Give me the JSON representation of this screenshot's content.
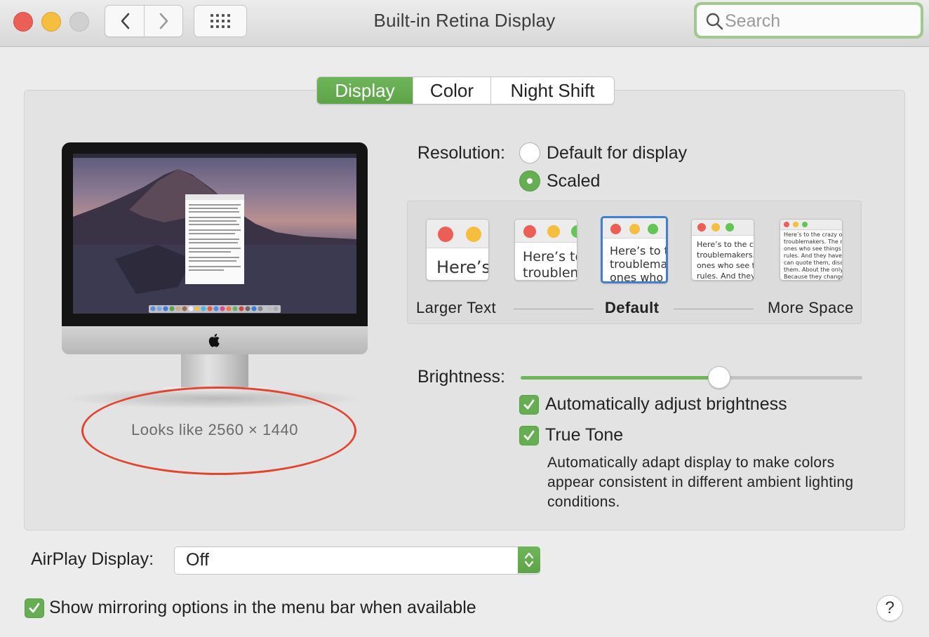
{
  "window": {
    "title": "Built-in Retina Display",
    "search_placeholder": "Search"
  },
  "tabs": [
    {
      "label": "Display",
      "selected": true
    },
    {
      "label": "Color",
      "selected": false
    },
    {
      "label": "Night Shift",
      "selected": false
    }
  ],
  "preview": {
    "looks_like": "Looks like 2560 × 1440",
    "annotation_color": "#e2442f"
  },
  "resolution": {
    "label": "Resolution:",
    "options": [
      {
        "label": "Default for display",
        "selected": false
      },
      {
        "label": "Scaled",
        "selected": true
      }
    ],
    "scale_captions": {
      "left": "Larger Text",
      "center": "Default",
      "right": "More Space"
    },
    "scale_thumbnails": [
      {
        "text": "Here’s"
      },
      {
        "text": "Here’s to\ntroublem"
      },
      {
        "text": "Here’s to t\ntroublema\nones who",
        "selected": true
      },
      {
        "text": "Here’s to the cr\ntroublemakers.\nones who see t\nrules. And they"
      },
      {
        "text": "Here’s to the crazy one\ntroublemakers. The rou\nones who see things dif\nrules. And they have no\ncan quote them, disagre\nthem. About the only th\nBecause they change th"
      }
    ]
  },
  "brightness": {
    "label": "Brightness:",
    "level": 0.58,
    "auto_adjust": {
      "label": "Automatically adjust brightness",
      "checked": true
    },
    "true_tone": {
      "label": "True Tone",
      "checked": true,
      "description": "Automatically adapt display to make colors appear consistent in different ambient lighting conditions."
    }
  },
  "airplay": {
    "label": "AirPlay Display:",
    "value": "Off"
  },
  "mirroring": {
    "label": "Show mirroring options in the menu bar when available",
    "checked": true
  },
  "help": {
    "label": "?"
  },
  "colors": {
    "accent_green": "#66ae52",
    "selection_blue": "#3f7fd6"
  }
}
